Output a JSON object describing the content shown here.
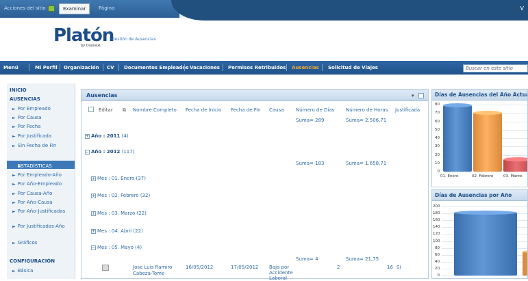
{
  "topbar": {
    "site_actions": "Acciones del sitio",
    "tab_examinar": "Examinar",
    "tab_pagina": "Página",
    "right_letter": "V"
  },
  "logo": {
    "name": "Platón",
    "by": "by Ouonext",
    "app_title": "Gestión de Ausencias"
  },
  "mainmenu": {
    "items": [
      "Menú",
      "Mi Perfil",
      "Organización",
      "CV",
      "Documentos Empleados",
      "Vacaciones",
      "Permisos Retribuidos",
      "Ausencias",
      "Solicitud de Viajes"
    ],
    "active": "Ausencias",
    "search_placeholder": "Buscar en este sitio"
  },
  "sidebar": {
    "inicio": "INICIO",
    "ausencias_head": "AUSENCIAS",
    "ausencias_items": [
      "Por Empleado",
      "Por Causa",
      "Por Fecha",
      "Por Justificada",
      "Sin Fecha de Fin"
    ],
    "estadisticas": "ESTADÍSTICAS",
    "estadisticas_items": [
      "Por Empleado-Año",
      "Por Año-Empleado",
      "Por Causa-Año",
      "Por Año-Causa",
      "Por Año-Justificadas",
      "Por Justificadas-Año",
      "Gráficos"
    ],
    "config_head": "CONFIGURACIÓN",
    "config_items": [
      "Básica"
    ]
  },
  "panel": {
    "title": "Ausencias",
    "columns": [
      "Editar",
      "Nombre Completo",
      "Fecha de Inicio",
      "Fecha de Fin",
      "Causa",
      "Número de Días",
      "Número de Horas",
      "Justificada"
    ],
    "total_days": "Suma= 289",
    "total_hours": "Suma= 2.506,71",
    "year_2011": "Año : 2011",
    "year_2011_count": "(4)",
    "year_2012": "Año : 2012",
    "year_2012_count": "(117)",
    "sum2012_days": "Suma= 183",
    "sum2012_hours": "Suma= 1.658,71",
    "months": [
      {
        "label": "Mes : 01. Enero (37)"
      },
      {
        "label": "Mes : 02. Febrero (32)"
      },
      {
        "label": "Mes : 03. Marzo (22)"
      },
      {
        "label": "Mes : 04. Abril (22)"
      },
      {
        "label": "Mes : 05. Mayo (4)"
      }
    ],
    "may_sum_days": "Suma= 4",
    "may_sum_hours": "Suma= 21,75",
    "row": {
      "name": "Jose Luis Ramiro Cabeza-Tome",
      "start": "16/05/2012",
      "end": "17/05/2012",
      "cause": "Baja por Accidente Laboral",
      "days": "2",
      "hours": "16",
      "justified": "Sí"
    }
  },
  "chart1": {
    "title": "Días de Ausencias del Año Actual"
  },
  "chart2": {
    "title": "Días de Ausencias por Año"
  },
  "chart_data": [
    {
      "type": "bar",
      "title": "Días de Ausencias del Año Actual",
      "categories": [
        "01. Enero",
        "02. Febrero",
        "03. Marzo"
      ],
      "values": [
        79,
        70,
        15
      ],
      "ylim": [
        0,
        80
      ],
      "yticks": [
        0,
        10,
        20,
        30,
        40,
        50,
        60,
        70,
        80
      ],
      "colors": [
        "#3a6fae",
        "#d9893a",
        "#c0464a"
      ]
    },
    {
      "type": "bar",
      "title": "Días de Ausencias por Año",
      "categories": [
        "2011",
        "2012"
      ],
      "values": [
        183,
        70
      ],
      "ylim": [
        0,
        200
      ],
      "yticks": [
        0,
        20,
        40,
        60,
        80,
        100,
        120,
        140,
        160,
        180,
        200
      ],
      "colors": [
        "#3a6fae",
        "#d9893a"
      ]
    }
  ]
}
